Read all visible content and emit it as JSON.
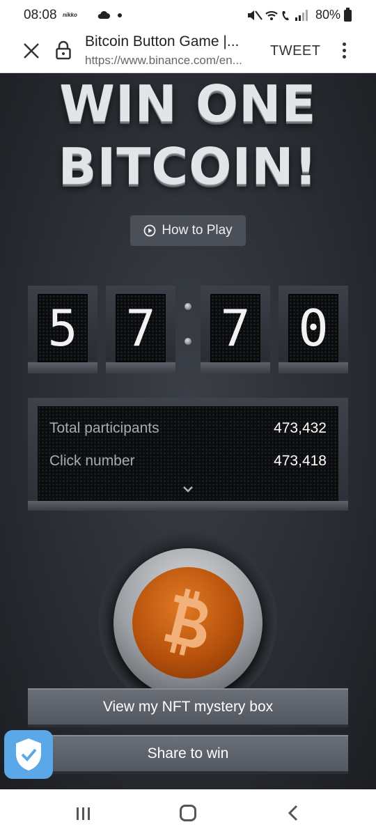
{
  "status_bar": {
    "time": "08:08",
    "carrier": "nikko",
    "battery": "80%"
  },
  "browser": {
    "title": "Bitcoin Button Game |...",
    "url": "https://www.binance.com/en...",
    "tweet_label": "TWEET"
  },
  "game": {
    "headline_line1": "WIN ONE",
    "headline_line2": "BITCOIN!",
    "how_to_play_label": "How to Play",
    "timer_digits": [
      "5",
      "7",
      "7",
      "0"
    ],
    "stats": [
      {
        "label": "Total participants",
        "value": "473,432"
      },
      {
        "label": "Click number",
        "value": "473,418"
      }
    ],
    "nft_button_label": "View my NFT mystery box",
    "share_button_label": "Share to win"
  },
  "colors": {
    "bitcoin_orange": "#b8520c",
    "button_gray": "#535760",
    "shield_blue": "#5aa8e8"
  },
  "icons": [
    "cloud-icon",
    "mute-icon",
    "wifi-icon",
    "call-icon",
    "signal-icon",
    "battery-icon",
    "close-icon",
    "lock-icon",
    "more-icon",
    "play-circle-icon",
    "chevron-down-icon",
    "bitcoin-icon",
    "shield-check-icon",
    "recent-apps-icon",
    "home-icon",
    "back-icon"
  ]
}
